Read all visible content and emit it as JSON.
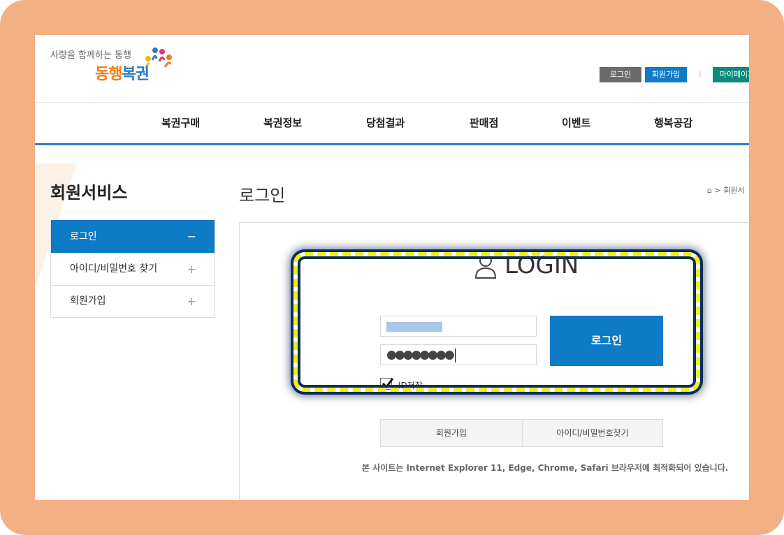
{
  "header": {
    "tagline": "사랑을 함께하는 동행",
    "logo_part1": "동행",
    "logo_part2": "복권",
    "top_buttons": {
      "login": "로그인",
      "join": "회원가입",
      "separator": "|",
      "mypage": "마이페이지"
    },
    "brand_colors": {
      "orange": "#f07d1a",
      "blue": "#2a7cc7",
      "teal": "#0d8a7c"
    }
  },
  "nav": {
    "items": [
      "복권구매",
      "복권정보",
      "당첨결과",
      "판매점",
      "이벤트",
      "행복공감"
    ]
  },
  "sidebar": {
    "title": "회원서비스",
    "items": [
      {
        "label": "로그인",
        "sign": "−",
        "active": true
      },
      {
        "label": "아이디/비밀번호 찾기",
        "sign": "+",
        "active": false
      },
      {
        "label": "회원가입",
        "sign": "+",
        "active": false
      }
    ]
  },
  "main": {
    "page_title": "로그인",
    "breadcrumb": {
      "home_icon": "home-icon",
      "separator": ">",
      "current": "회원서"
    },
    "login_heading": "LOGIN",
    "id_field": {
      "value": ""
    },
    "pw_field": {
      "value": "●●●●●●●●"
    },
    "login_button": "로그인",
    "remember_id": {
      "label": "ID저장",
      "checked": true
    },
    "sub_buttons": {
      "join": "회원가입",
      "find": "아이디/비밀번호찾기"
    },
    "notice": "본 사이트는 Internet Explorer 11, Edge, Chrome, Safari 브라우저에 최적화되어 있습니다.",
    "accent_color": "#0d7bc6"
  }
}
